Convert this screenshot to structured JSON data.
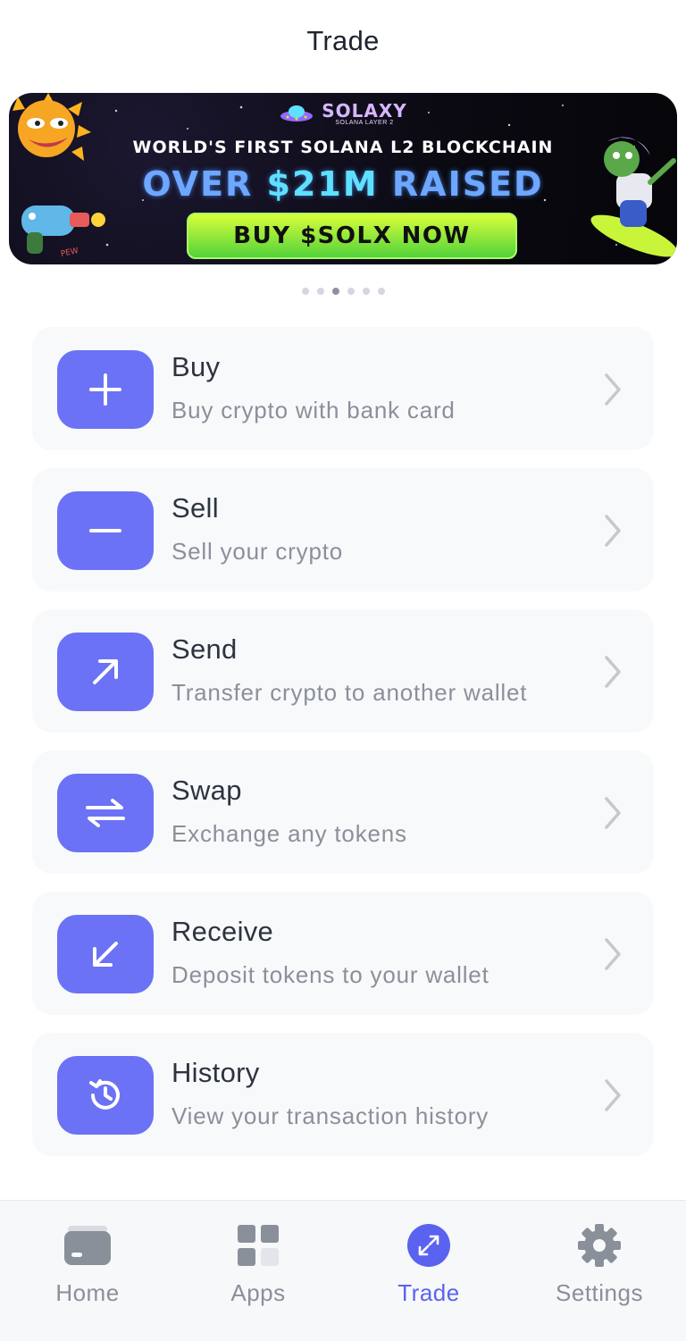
{
  "header": {
    "title": "Trade"
  },
  "banner": {
    "brand": "SOLAXY",
    "brand_sub": "SOLANA LAYER 2",
    "headline": "WORLD'S FIRST SOLANA L2 BLOCKCHAIN",
    "big_prefix": "OVER ",
    "big_amount": "$21M",
    "big_suffix": " RAISED",
    "cta": "BUY $SOLX NOW",
    "doodle_text": "PEW"
  },
  "carousel": {
    "total": 6,
    "active_index": 2
  },
  "menu": [
    {
      "title": "Buy",
      "subtitle": "Buy crypto with bank card",
      "icon": "plus-icon"
    },
    {
      "title": "Sell",
      "subtitle": "Sell your crypto",
      "icon": "minus-icon"
    },
    {
      "title": "Send",
      "subtitle": "Transfer crypto to another wallet",
      "icon": "arrow-up-right-icon"
    },
    {
      "title": "Swap",
      "subtitle": "Exchange any tokens",
      "icon": "swap-arrows-icon"
    },
    {
      "title": "Receive",
      "subtitle": "Deposit tokens to your wallet",
      "icon": "arrow-down-left-icon"
    },
    {
      "title": "History",
      "subtitle": "View your transaction history",
      "icon": "history-clock-icon"
    }
  ],
  "tabs": [
    {
      "label": "Home",
      "icon": "wallet-card-icon",
      "active": false
    },
    {
      "label": "Apps",
      "icon": "apps-grid-icon",
      "active": false
    },
    {
      "label": "Trade",
      "icon": "trade-arrows-icon",
      "active": true
    },
    {
      "label": "Settings",
      "icon": "gear-icon",
      "active": false
    }
  ],
  "colors": {
    "accent": "#6b72f5",
    "active_tab": "#5a62f0",
    "card_bg": "#f8f9fb",
    "muted_text": "#8a909a"
  }
}
